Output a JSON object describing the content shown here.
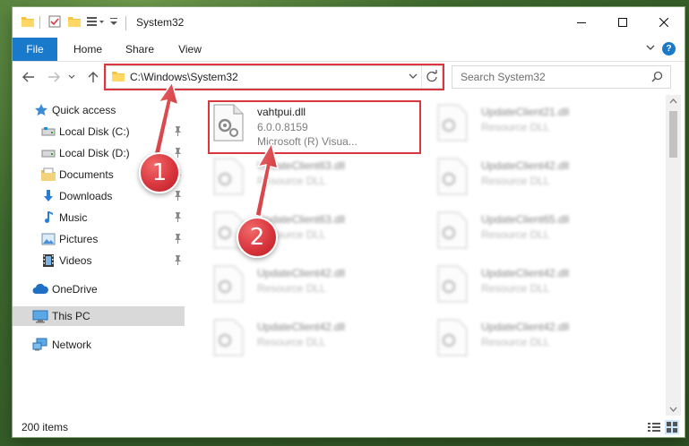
{
  "window": {
    "title": "System32"
  },
  "ribbon": {
    "tabs": [
      "File",
      "Home",
      "Share",
      "View"
    ],
    "help_label": "?"
  },
  "address": {
    "path": "C:\\Windows\\System32"
  },
  "search": {
    "placeholder": "Search System32"
  },
  "sidebar": {
    "items": [
      {
        "label": "Quick access",
        "icon": "star-icon",
        "pinned": false
      },
      {
        "label": "Local Disk (C:)",
        "icon": "drive-icon",
        "pinned": true
      },
      {
        "label": "Local Disk (D:)",
        "icon": "drive-icon",
        "pinned": true
      },
      {
        "label": "Documents",
        "icon": "documents-icon",
        "pinned": true
      },
      {
        "label": "Downloads",
        "icon": "download-icon",
        "pinned": true
      },
      {
        "label": "Music",
        "icon": "music-icon",
        "pinned": true
      },
      {
        "label": "Pictures",
        "icon": "pictures-icon",
        "pinned": true
      },
      {
        "label": "Videos",
        "icon": "videos-icon",
        "pinned": true
      },
      {
        "label": "OneDrive",
        "icon": "cloud-icon",
        "pinned": false
      },
      {
        "label": "This PC",
        "icon": "computer-icon",
        "pinned": false,
        "selected": true
      },
      {
        "label": "Network",
        "icon": "network-icon",
        "pinned": false
      }
    ]
  },
  "files": [
    {
      "name": "vahtpui.dll",
      "desc1": "6.0.0.8159",
      "desc2": "Microsoft (R) Visua...",
      "highlighted": true
    },
    {
      "name": "UpdateClient21.dll",
      "desc1": "Resource DLL"
    },
    {
      "name": "UpdateClient63.dll",
      "desc1": "Resource DLL"
    },
    {
      "name": "UpdateClient42.dll",
      "desc1": "Resource DLL"
    },
    {
      "name": "UpdateClient63.dll",
      "desc1": "Resource DLL"
    },
    {
      "name": "UpdateClient65.dll",
      "desc1": "Resource DLL"
    },
    {
      "name": "UpdateClient42.dll",
      "desc1": "Resource DLL"
    },
    {
      "name": "UpdateClient42.dll",
      "desc1": "Resource DLL"
    },
    {
      "name": "UpdateClient42.dll",
      "desc1": "Resource DLL"
    },
    {
      "name": "UpdateClient42.dll",
      "desc1": "Resource DLL"
    }
  ],
  "status": {
    "item_count": "200 items"
  },
  "callouts": [
    "1",
    "2"
  ],
  "colors": {
    "accent": "#1979ca",
    "highlight": "#d9363e",
    "selected": "#d9d9d9"
  }
}
